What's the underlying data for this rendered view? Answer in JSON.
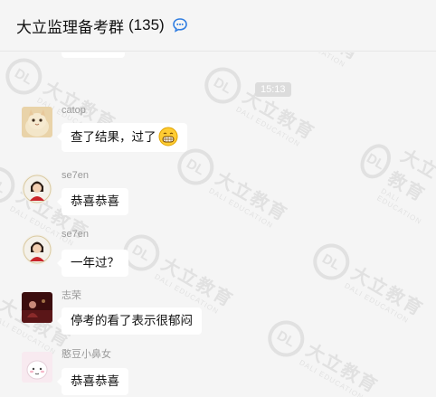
{
  "header": {
    "title": "大立监理备考群",
    "member_count": "(135)",
    "icon": "chat-bubble-icon"
  },
  "watermark": {
    "logo": "DL",
    "cn": "大立教育",
    "en": "DALI EDUCATION"
  },
  "timestamp": "15:13",
  "messages": [
    {
      "sender": "catop",
      "text": "查了结果，过了",
      "emoji": "grinning-face-icon",
      "avatar": "cat-avatar"
    },
    {
      "sender": "se7en",
      "text": "恭喜恭喜",
      "avatar": "girl-red-avatar"
    },
    {
      "sender": "se7en",
      "text": "一年过？",
      "avatar": "girl-red-avatar"
    },
    {
      "sender": "志荣",
      "text": "停考的看了表示很郁闷",
      "avatar": "dark-photo-avatar"
    },
    {
      "sender": "憨豆小鼻女",
      "text": "恭喜恭喜",
      "avatar": "cartoon-pink-avatar"
    }
  ]
}
